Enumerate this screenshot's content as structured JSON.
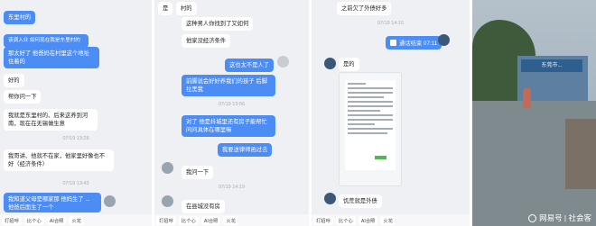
{
  "panel1": {
    "messages": [
      {
        "text": "东里村的",
        "side": "out"
      },
      {
        "text": "该调入业 如何现在我是东里村的",
        "side": "out"
      },
      {
        "text": "那太好了 他爸妈在村里这个地址住着的",
        "side": "out"
      },
      {
        "text": "好的",
        "side": "in"
      },
      {
        "text": "帮你问一下",
        "side": "in"
      },
      {
        "text": "我就是东里村的、后来这养到河南，现在在无锡做生意",
        "side": "in"
      },
      {
        "text": "07/19 13:28",
        "side": "time"
      },
      {
        "text": "我哥讲、他就不在家，他家里好像也不好（经济条件）",
        "side": "in"
      },
      {
        "text": "07/19 13:43",
        "side": "time"
      },
      {
        "text": "我知道父母是哪家那 他妈生了 ... 他爸后面生了一个",
        "side": "out"
      }
    ],
    "actions": [
      "打招呼",
      "比个心",
      "AI合照",
      "火花"
    ]
  },
  "panel2": {
    "messages": [
      {
        "text": "是",
        "side": "in"
      },
      {
        "text": "村的",
        "side": "in"
      },
      {
        "text": "这种男人你找到了又如何",
        "side": "in"
      },
      {
        "text": "他家没经济条件",
        "side": "in"
      },
      {
        "text": "这也太不是人了",
        "side": "out"
      },
      {
        "text": "前脚说会好好养我们的孩子 后脚拉黑我",
        "side": "out"
      },
      {
        "text": "07/19 13:56",
        "side": "time"
      },
      {
        "text": "对了 他是抖城里还有房子能帮忙问问具体在哪里嘛",
        "side": "out"
      },
      {
        "text": "我要送律师函过去",
        "side": "out"
      },
      {
        "text": "我问一下",
        "side": "in"
      },
      {
        "text": "07/19 14:19",
        "side": "time"
      },
      {
        "text": "在县城没有房",
        "side": "in"
      }
    ],
    "actions": [
      "打招呼",
      "比个心",
      "AI合照",
      "火花"
    ]
  },
  "panel3": {
    "messages": [
      {
        "text": "之前欠了外债好多",
        "side": "in"
      },
      {
        "text": "07/19 14:15",
        "side": "time"
      },
      {
        "text": "通话结束 07:11",
        "side": "out"
      },
      {
        "text": "是的",
        "side": "in"
      },
      {
        "text": "饥荒就是外债",
        "side": "in"
      }
    ],
    "actions": [
      "打招呼",
      "比个心",
      "AI合照",
      "火花"
    ]
  },
  "panel4": {
    "sign": "东莞市...",
    "watermark": "网易号 | 社会客"
  },
  "colors": {
    "accent": "#4c8cf5",
    "panel_bg": "#eef0f4"
  }
}
